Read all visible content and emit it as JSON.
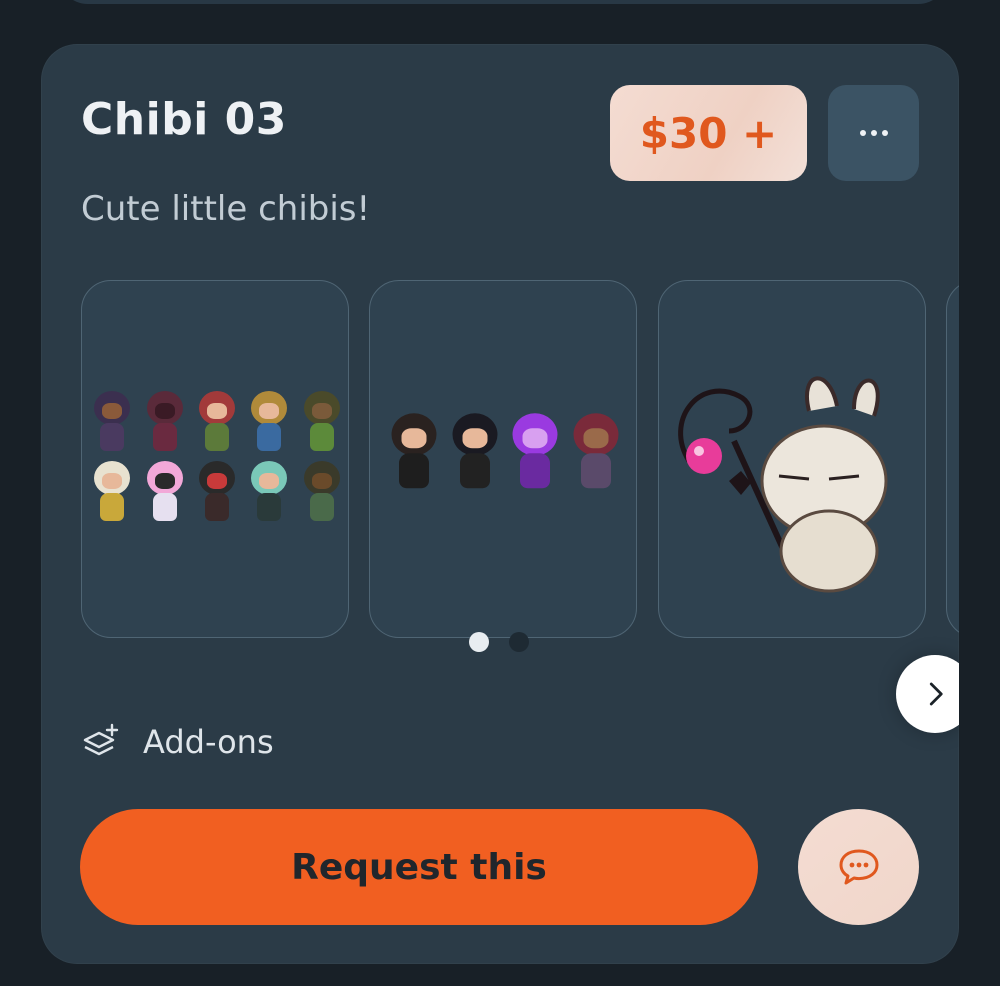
{
  "card": {
    "title": "Chibi 03",
    "description": "Cute little chibis!",
    "price": "$30 +",
    "more_icon": "ellipsis-icon"
  },
  "gallery": {
    "images": [
      "chibi-group-10",
      "chibi-group-4",
      "chibi-bunny-mage"
    ],
    "next_icon": "chevron-right-icon",
    "page_count": 2,
    "active_page": 1
  },
  "addons": {
    "label": "Add-ons",
    "icon": "layers-plus-icon"
  },
  "actions": {
    "request_label": "Request this",
    "chat_icon": "chat-bubble-icon"
  },
  "colors": {
    "accent": "#f15f21",
    "price_text": "#e0581e",
    "card_bg": "#2b3b47",
    "page_bg": "#182027"
  }
}
